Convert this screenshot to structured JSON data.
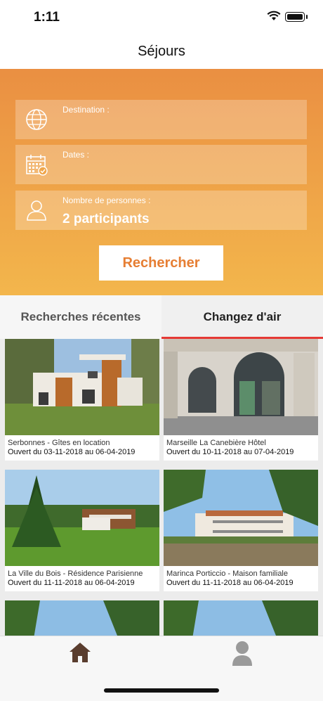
{
  "status_bar": {
    "time": "1:11"
  },
  "nav": {
    "title": "Séjours"
  },
  "search": {
    "destination": {
      "label": "Destination :",
      "value": ""
    },
    "dates": {
      "label": "Dates :",
      "value": ""
    },
    "persons": {
      "label": "Nombre de personnes :",
      "value": "2 participants"
    },
    "button_label": "Rechercher"
  },
  "tabs": [
    {
      "label": "Recherches récentes",
      "active": false
    },
    {
      "label": "Changez d'air",
      "active": true
    }
  ],
  "colors": {
    "accent_orange": "#e67e33",
    "gradient_top": "#ea8f42",
    "gradient_bottom": "#f3b64c",
    "tab_underline": "#e53935"
  },
  "listings": [
    {
      "name": "Serbonnes - Gîtes en location",
      "dates": "Ouvert du 03-11-2018 au 06-04-2019"
    },
    {
      "name": "Marseille La Canebière Hôtel",
      "dates": "Ouvert du 10-11-2018 au 07-04-2019"
    },
    {
      "name": "La Ville du Bois - Résidence Parisienne",
      "dates": "Ouvert du 11-11-2018 au 06-04-2019"
    },
    {
      "name": "Marinca Porticcio - Maison familiale",
      "dates": "Ouvert du 11-11-2018 au 06-04-2019"
    },
    {
      "name": "",
      "dates": ""
    },
    {
      "name": "",
      "dates": ""
    }
  ],
  "tabbar": {
    "items": [
      "home-icon",
      "profile-icon"
    ]
  }
}
